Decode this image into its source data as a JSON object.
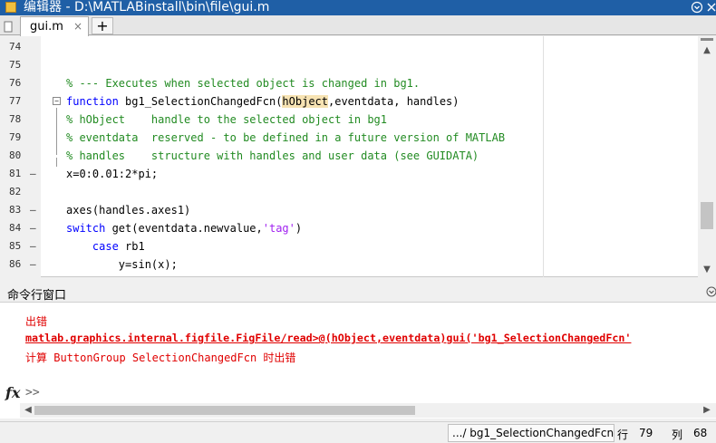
{
  "window": {
    "title": "编辑器 - D:\\MATLABinstall\\bin\\file\\gui.m",
    "help_icon": "circle-help-icon",
    "close_icon": "close-icon"
  },
  "tabs": [
    {
      "label": "gui.m",
      "close": "×"
    }
  ],
  "new_tab_label": "+",
  "editor": {
    "lines": [
      {
        "num": "74",
        "mark": "",
        "segments": []
      },
      {
        "num": "75",
        "mark": "",
        "segments": []
      },
      {
        "num": "76",
        "mark": "",
        "segments": [
          {
            "t": "% --- Executes when selected object is changed in bg1.",
            "c": "cm"
          }
        ]
      },
      {
        "num": "77",
        "mark": "",
        "segments": [
          {
            "t": "function ",
            "c": "kw"
          },
          {
            "t": "bg1_SelectionChangedFcn(",
            "c": ""
          },
          {
            "t": "hObject",
            "c": "hl"
          },
          {
            "t": ",eventdata, handles)",
            "c": ""
          }
        ]
      },
      {
        "num": "78",
        "mark": "",
        "segments": [
          {
            "t": "% hObject    handle to the selected object in bg1",
            "c": "cm"
          }
        ]
      },
      {
        "num": "79",
        "mark": "",
        "segments": [
          {
            "t": "% eventdata  reserved - to be defined in a future version of MATLAB",
            "c": "cm"
          }
        ]
      },
      {
        "num": "80",
        "mark": "",
        "segments": [
          {
            "t": "% handles    structure with handles and user data (see GUIDATA)",
            "c": "cm"
          }
        ]
      },
      {
        "num": "81",
        "mark": "—",
        "segments": [
          {
            "t": "x=0:0.01:2*pi;",
            "c": ""
          }
        ]
      },
      {
        "num": "82",
        "mark": "",
        "segments": []
      },
      {
        "num": "83",
        "mark": "—",
        "segments": [
          {
            "t": "axes(handles.axes1)",
            "c": ""
          }
        ]
      },
      {
        "num": "84",
        "mark": "—",
        "segments": [
          {
            "t": "switch ",
            "c": "kw"
          },
          {
            "t": "get(eventdata.newvalue,",
            "c": ""
          },
          {
            "t": "'tag'",
            "c": "str"
          },
          {
            "t": ")",
            "c": ""
          }
        ]
      },
      {
        "num": "85",
        "mark": "—",
        "segments": [
          {
            "t": "    case ",
            "c": "kw"
          },
          {
            "t": "rb1",
            "c": ""
          }
        ]
      },
      {
        "num": "86",
        "mark": "—",
        "segments": [
          {
            "t": "        y=sin(x);",
            "c": ""
          }
        ]
      }
    ]
  },
  "command_window": {
    "title": "命令行窗口",
    "error_label": "出错",
    "error_link": "matlab.graphics.internal.figfile.FigFile/read>@(hObject,eventdata)gui('bg1_SelectionChangedFcn'",
    "error_msg": "计算 ButtonGroup SelectionChangedFcn 时出错",
    "fx_label": "fx",
    "prompt": ">>"
  },
  "status": {
    "function_path": ".../ bg1_SelectionChangedFcn",
    "row_label": "行",
    "row_value": "79",
    "col_label": "列",
    "col_value": "68"
  }
}
